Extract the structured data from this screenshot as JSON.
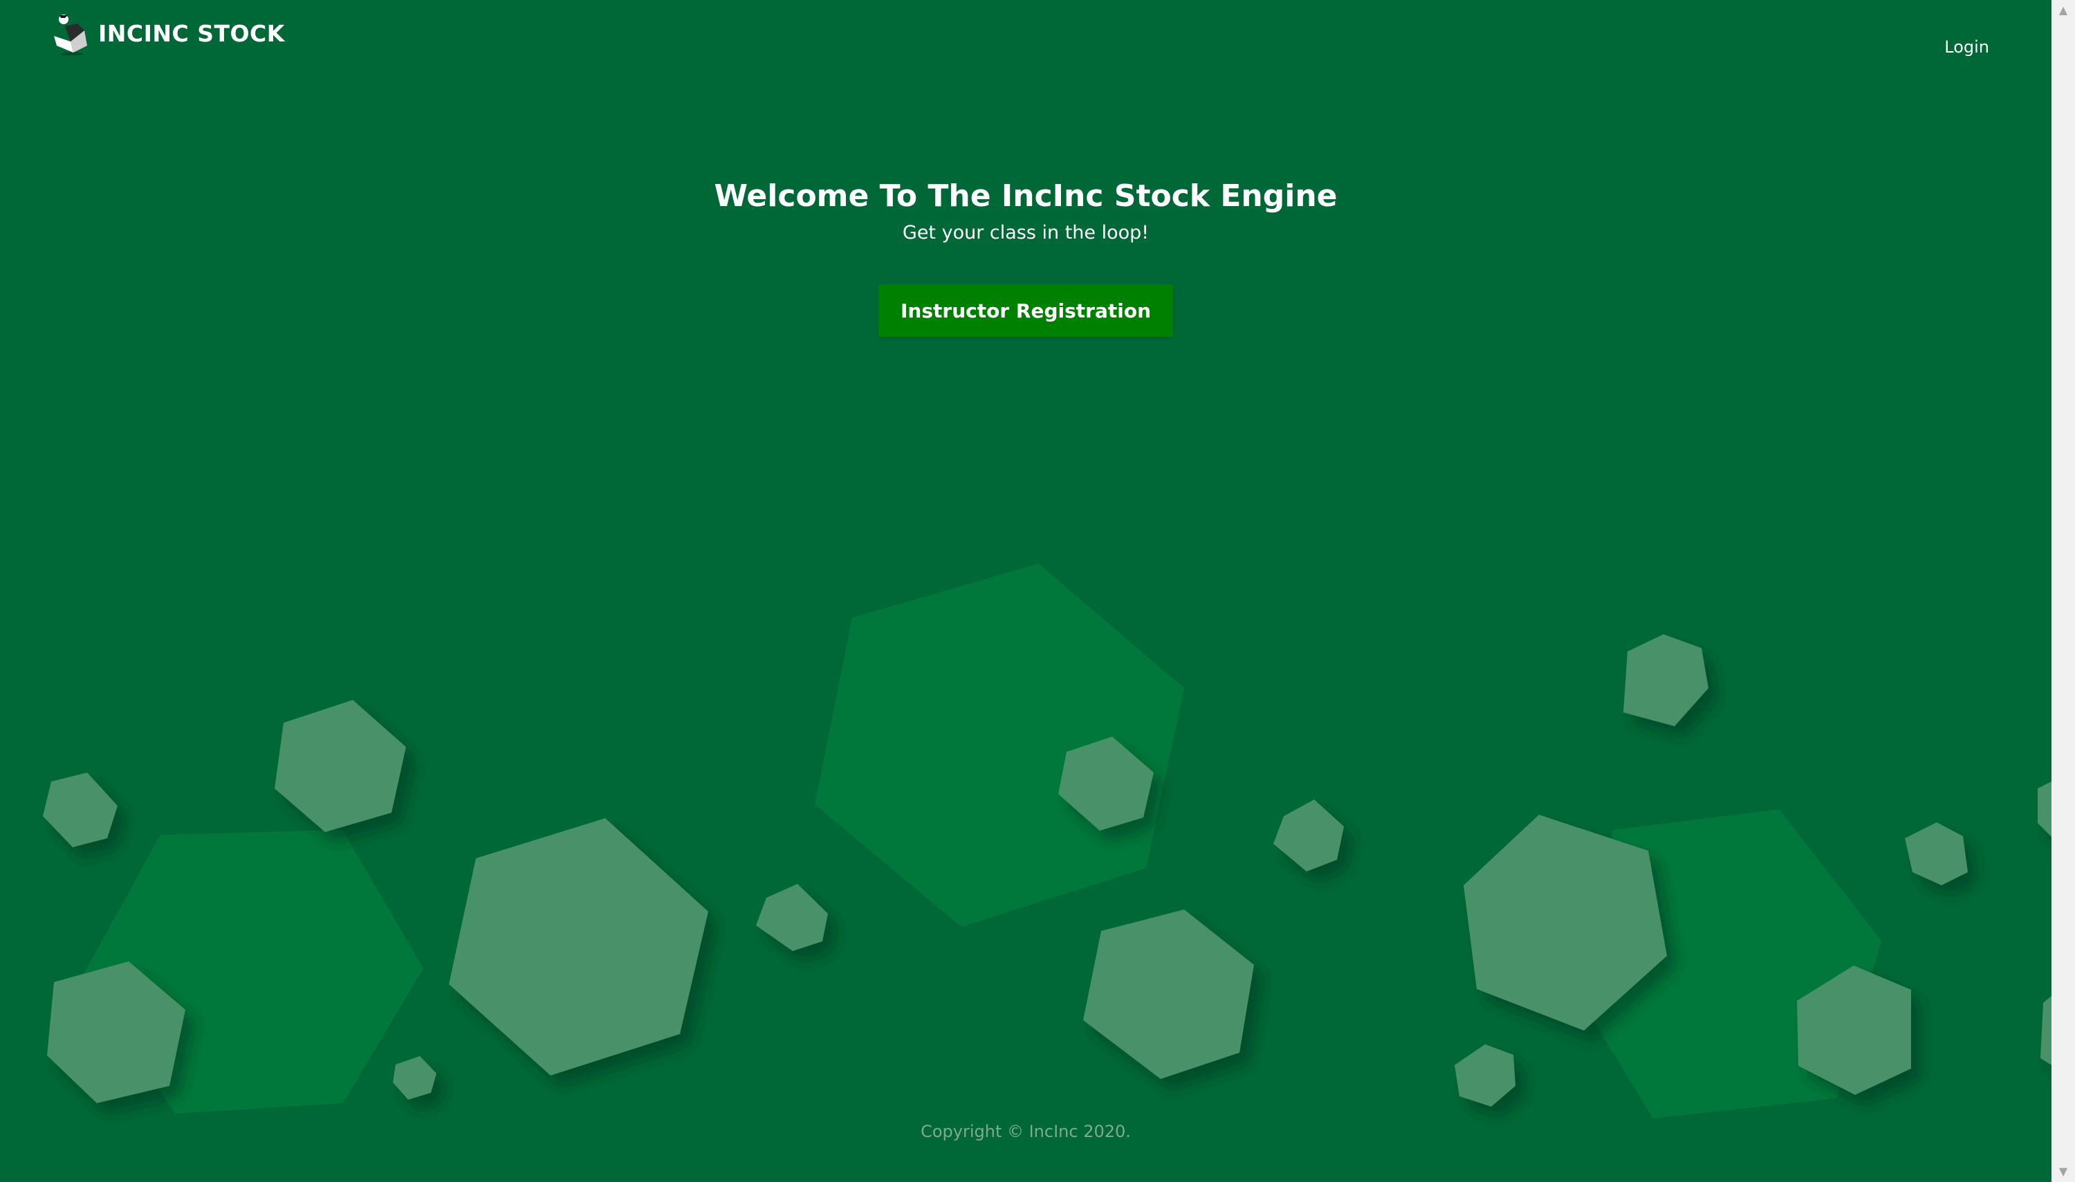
{
  "brand": {
    "name": "INCINC STOCK",
    "logo_icon": "incinc-logo-icon"
  },
  "nav": {
    "login_label": "Login"
  },
  "hero": {
    "title": "Welcome To The IncInc Stock Engine",
    "subtitle": "Get your class in the loop!",
    "cta_label": "Instructor Registration"
  },
  "footer": {
    "copyright": "Copyright © IncInc 2020."
  },
  "scrollbar": {
    "up_glyph": "▲",
    "down_glyph": "▼"
  },
  "colors": {
    "background": "#006837",
    "button": "#008000",
    "hex_light": "#4a9169",
    "hex_dark": "#00783c",
    "footer_text": "#7fa992",
    "text": "#ffffff"
  }
}
